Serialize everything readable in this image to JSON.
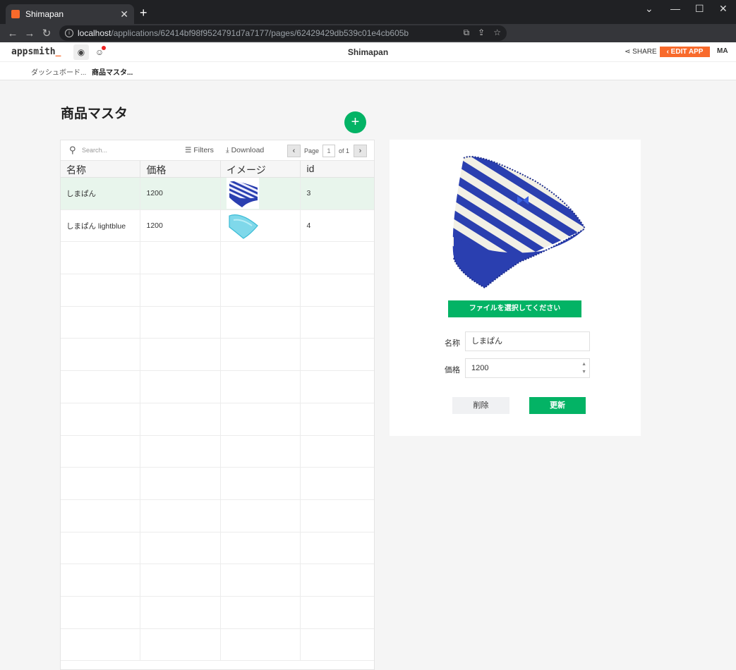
{
  "browser": {
    "tab_title": "Shimapan",
    "tab_close": "✕",
    "new_tab": "+",
    "url_host": "localhost",
    "url_path": "/applications/62414bf98f9524791d7a7177/pages/62429429db539c01e4cb605b",
    "window_controls": {
      "minimize": "⌄",
      "restore": "—",
      "maximize": "☐",
      "close": "✕"
    }
  },
  "header": {
    "logo": "appsmith",
    "app_title": "Shimapan",
    "share_label": "SHARE",
    "edit_label": "EDIT APP",
    "avatar": "MA"
  },
  "pages": [
    {
      "label": "ダッシュボード..."
    },
    {
      "label": "商品マスタ..."
    }
  ],
  "main": {
    "heading": "商品マスタ",
    "add_button": "+"
  },
  "table": {
    "search_placeholder": "Search...",
    "filters_label": "Filters",
    "download_label": "Download",
    "page_label": "Page",
    "page_current": "1",
    "page_of": "of 1",
    "columns": [
      "名称",
      "価格",
      "イメージ",
      "id"
    ],
    "rows": [
      {
        "name": "しまぱん",
        "price": "1200",
        "image": "blue-striped",
        "id": "3"
      },
      {
        "name": "しまぱん lightblue",
        "price": "1200",
        "image": "lightblue",
        "id": "4"
      }
    ]
  },
  "detail": {
    "file_button": "ファイルを選択してください",
    "name_label": "名称",
    "name_value": "しまぱん",
    "price_label": "価格",
    "price_value": "1200",
    "delete_label": "削除",
    "update_label": "更新"
  },
  "colors": {
    "brand": "#f86a2b",
    "primary_green": "#03b365",
    "selected_row": "#e8f5ec",
    "stripe_blue": "#2a3fb0"
  }
}
